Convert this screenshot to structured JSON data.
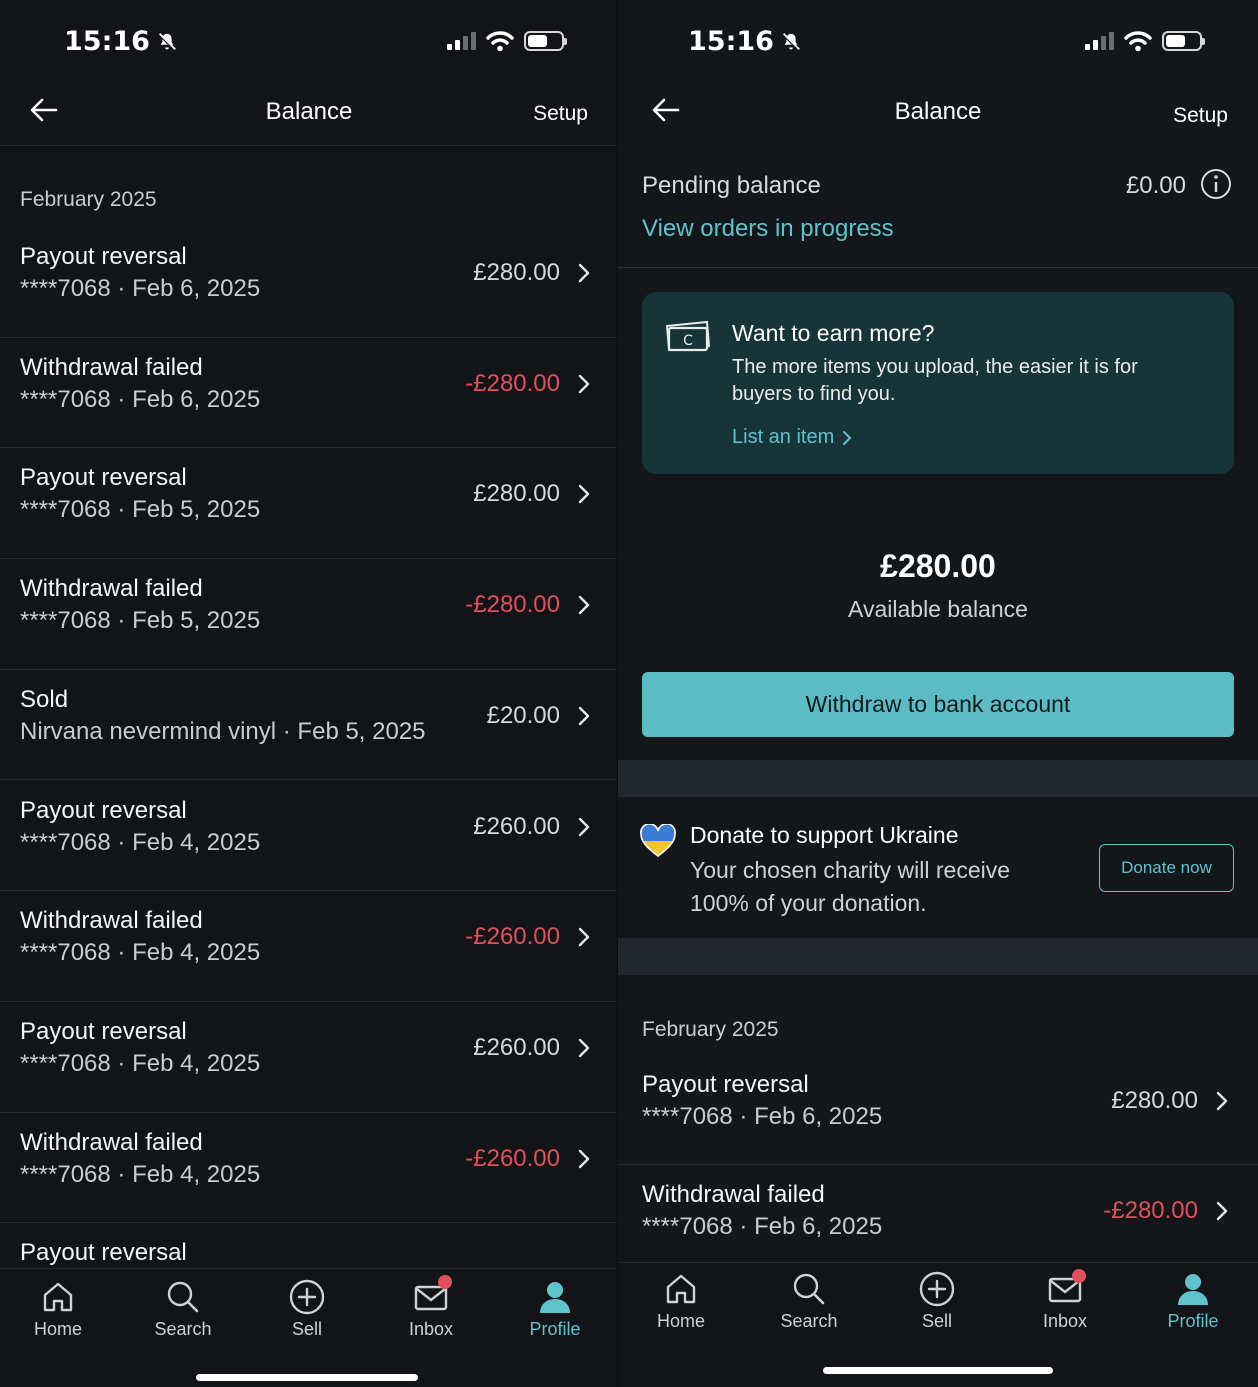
{
  "left": {
    "status": {
      "time": "15:16"
    },
    "header": {
      "title": "Balance",
      "setup": "Setup"
    },
    "month": "February 2025",
    "transactions": [
      {
        "title": "Payout reversal",
        "subtitle": "****7068 · Feb 6, 2025",
        "amount": "£280.00",
        "negative": false
      },
      {
        "title": "Withdrawal failed",
        "subtitle": "****7068 · Feb 6, 2025",
        "amount": "-£280.00",
        "negative": true
      },
      {
        "title": "Payout reversal",
        "subtitle": "****7068 · Feb 5, 2025",
        "amount": "£280.00",
        "negative": false
      },
      {
        "title": "Withdrawal failed",
        "subtitle": "****7068 · Feb 5, 2025",
        "amount": "-£280.00",
        "negative": true
      },
      {
        "title": "Sold",
        "subtitle": "Nirvana nevermind vinyl · Feb 5, 2025",
        "amount": "£20.00",
        "negative": false
      },
      {
        "title": "Payout reversal",
        "subtitle": "****7068 · Feb 4, 2025",
        "amount": "£260.00",
        "negative": false
      },
      {
        "title": "Withdrawal failed",
        "subtitle": "****7068 · Feb 4, 2025",
        "amount": "-£260.00",
        "negative": true
      },
      {
        "title": "Payout reversal",
        "subtitle": "****7068 · Feb 4, 2025",
        "amount": "£260.00",
        "negative": false
      },
      {
        "title": "Withdrawal failed",
        "subtitle": "****7068 · Feb 4, 2025",
        "amount": "-£260.00",
        "negative": true
      },
      {
        "title": "Payout reversal",
        "subtitle": "",
        "amount": "",
        "negative": false
      }
    ],
    "tabs": {
      "home": "Home",
      "search": "Search",
      "sell": "Sell",
      "inbox": "Inbox",
      "profile": "Profile"
    }
  },
  "right": {
    "status": {
      "time": "15:16"
    },
    "header": {
      "title": "Balance",
      "setup": "Setup"
    },
    "pending": {
      "label": "Pending balance",
      "amount": "£0.00",
      "link": "View orders in progress"
    },
    "promo": {
      "title": "Want to earn more?",
      "text": "The more items you upload, the easier it is for buyers to find you.",
      "link": "List an item",
      "cash_symbol": "C"
    },
    "available": {
      "amount": "£280.00",
      "label": "Available balance"
    },
    "withdraw_button": "Withdraw to bank account",
    "donate": {
      "title": "Donate to support Ukraine",
      "text": "Your chosen charity will receive 100% of your donation.",
      "button": "Donate now"
    },
    "month": "February 2025",
    "transactions": [
      {
        "title": "Payout reversal",
        "subtitle": "****7068 · Feb 6, 2025",
        "amount": "£280.00",
        "negative": false
      },
      {
        "title": "Withdrawal failed",
        "subtitle": "****7068 · Feb 6, 2025",
        "amount": "-£280.00",
        "negative": true
      }
    ],
    "tabs": {
      "home": "Home",
      "search": "Search",
      "sell": "Sell",
      "inbox": "Inbox",
      "profile": "Profile"
    }
  },
  "colors": {
    "accent": "#5fc3cc",
    "negative": "#e0505c",
    "button": "#5cbcc4",
    "promo_bg": "#173539"
  }
}
